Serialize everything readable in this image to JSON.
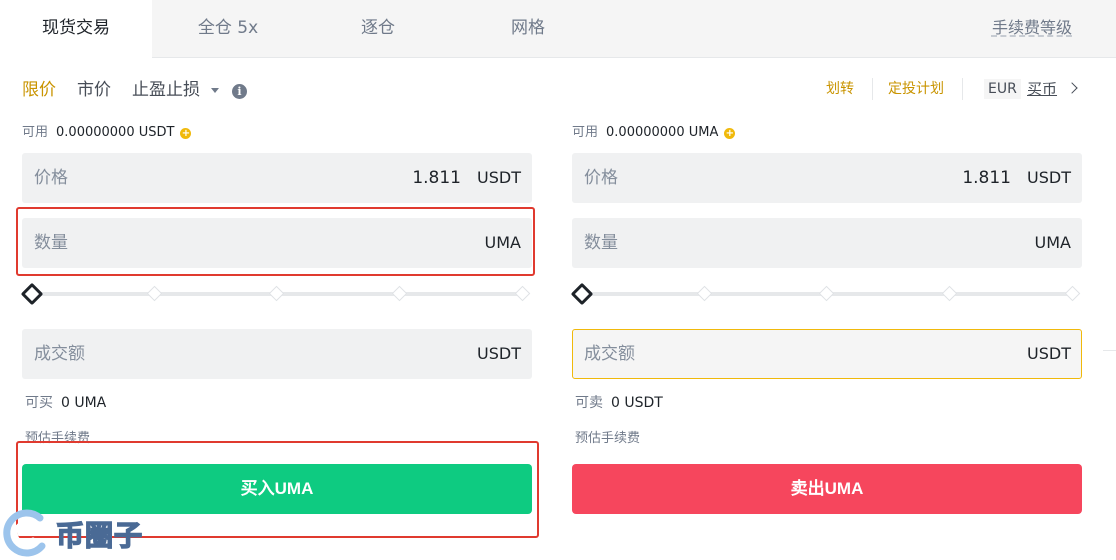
{
  "tabs": {
    "spot": "现货交易",
    "cross": "全仓 5x",
    "isolated": "逐仓",
    "grid": "网格",
    "fee_level": "手续费等级"
  },
  "order_types": {
    "limit": "限价",
    "market": "市价",
    "stop": "止盈止损"
  },
  "top_links": {
    "transfer": "划转",
    "auto_invest": "定投计划",
    "currency": "EUR",
    "buy_crypto": "买币"
  },
  "buy": {
    "available_label": "可用",
    "available_value": "0.00000000 USDT",
    "price_label": "价格",
    "price_value": "1.811",
    "price_unit": "USDT",
    "qty_label": "数量",
    "qty_unit": "UMA",
    "slider_percent": 0,
    "total_label": "成交额",
    "total_unit": "USDT",
    "can_label": "可买",
    "can_value": "0 UMA",
    "fee_label": "预估手续费",
    "button": "买入UMA"
  },
  "sell": {
    "available_label": "可用",
    "available_value": "0.00000000 UMA",
    "price_label": "价格",
    "price_value": "1.811",
    "price_unit": "USDT",
    "qty_label": "数量",
    "qty_unit": "UMA",
    "slider_percent": 0,
    "total_label": "成交额",
    "total_unit": "USDT",
    "can_label": "可卖",
    "can_value": "0 USDT",
    "fee_label": "预估手续费",
    "button": "卖出UMA"
  },
  "watermark": "币圈子",
  "colors": {
    "accent": "#c99400",
    "buy": "#0ecb81",
    "sell": "#f6465d",
    "annotation": "#e03a2f"
  }
}
